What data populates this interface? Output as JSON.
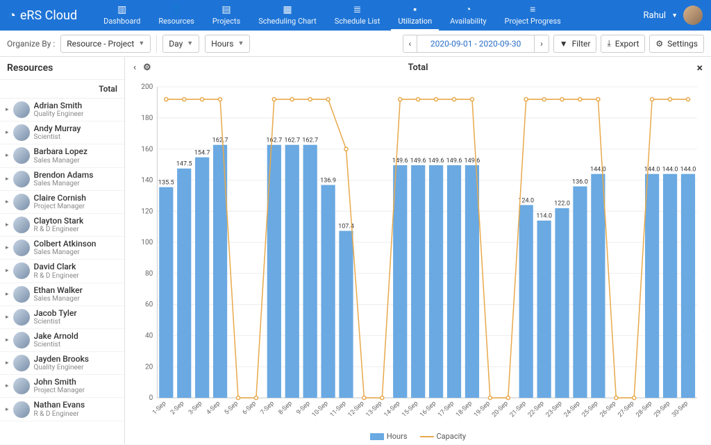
{
  "brand": "eRS Cloud",
  "nav": [
    {
      "label": "Dashboard",
      "icon": "▥"
    },
    {
      "label": "Resources",
      "icon": "👤"
    },
    {
      "label": "Projects",
      "icon": "▤"
    },
    {
      "label": "Scheduling Chart",
      "icon": "▦"
    },
    {
      "label": "Schedule List",
      "icon": "≣"
    },
    {
      "label": "Utilization",
      "icon": "▪",
      "active": true
    },
    {
      "label": "Availability",
      "icon": "◔"
    },
    {
      "label": "Project Progress",
      "icon": "≡"
    }
  ],
  "user_name": "Rahul",
  "toolbar": {
    "organize_label": "Organize By :",
    "organize_value": "Resource - Project",
    "granularity": "Day",
    "unit": "Hours",
    "date_range": "2020-09-01 - 2020-09-30",
    "filter": "Filter",
    "export": "Export",
    "settings": "Settings"
  },
  "sidebar": {
    "title": "Resources",
    "sub": "Total",
    "items": [
      {
        "name": "Adrian Smith",
        "role": "Quality Engineer"
      },
      {
        "name": "Andy Murray",
        "role": "Scientist"
      },
      {
        "name": "Barbara Lopez",
        "role": "Sales Manager"
      },
      {
        "name": "Brendon Adams",
        "role": "Sales Manager"
      },
      {
        "name": "Claire Cornish",
        "role": "Project Manager"
      },
      {
        "name": "Clayton Stark",
        "role": "R & D Engineer"
      },
      {
        "name": "Colbert Atkinson",
        "role": "Sales Manager"
      },
      {
        "name": "David Clark",
        "role": "R & D Engineer"
      },
      {
        "name": "Ethan Walker",
        "role": "Sales Manager"
      },
      {
        "name": "Jacob Tyler",
        "role": "Scientist"
      },
      {
        "name": "Jake Arnold",
        "role": "Scientist"
      },
      {
        "name": "Jayden Brooks",
        "role": "Quality Engineer"
      },
      {
        "name": "John Smith",
        "role": "Project Manager"
      },
      {
        "name": "Nathan Evans",
        "role": "R & D Engineer"
      }
    ]
  },
  "chart": {
    "title": "Total",
    "legend": {
      "hours": "Hours",
      "capacity": "Capacity"
    }
  },
  "colors": {
    "bar": "#6aa9e2",
    "capacity": "#e8a94c",
    "accent": "#1e74d6"
  },
  "chart_data": {
    "type": "bar",
    "title": "Total",
    "ylabel": "",
    "ylim": [
      0,
      200
    ],
    "yticks": [
      0,
      20,
      40,
      60,
      80,
      100,
      120,
      140,
      160,
      180,
      200
    ],
    "categories": [
      "1-Sep",
      "2-Sep",
      "3-Sep",
      "4-Sep",
      "5-Sep",
      "6-Sep",
      "7-Sep",
      "8-Sep",
      "9-Sep",
      "10-Sep",
      "11-Sep",
      "12-Sep",
      "13-Sep",
      "14-Sep",
      "15-Sep",
      "16-Sep",
      "17-Sep",
      "18-Sep",
      "19-Sep",
      "20-Sep",
      "21-Sep",
      "22-Sep",
      "23-Sep",
      "24-Sep",
      "25-Sep",
      "26-Sep",
      "27-Sep",
      "28-Sep",
      "29-Sep",
      "30-Sep"
    ],
    "series": [
      {
        "name": "Hours",
        "type": "bar",
        "values": [
          135.5,
          147.5,
          154.7,
          162.7,
          0,
          0,
          162.7,
          162.7,
          162.7,
          136.9,
          107.4,
          0,
          0,
          149.6,
          149.6,
          149.6,
          149.6,
          149.6,
          0,
          0,
          124.0,
          114.0,
          122.0,
          136.0,
          144.0,
          0,
          0,
          144.0,
          144.0,
          144.0
        ]
      },
      {
        "name": "Capacity",
        "type": "line",
        "values": [
          192,
          192,
          192,
          192,
          0,
          0,
          192,
          192,
          192,
          192,
          160,
          0,
          0,
          192,
          192,
          192,
          192,
          192,
          0,
          0,
          192,
          192,
          192,
          192,
          192,
          0,
          0,
          192,
          192,
          192
        ]
      }
    ]
  }
}
